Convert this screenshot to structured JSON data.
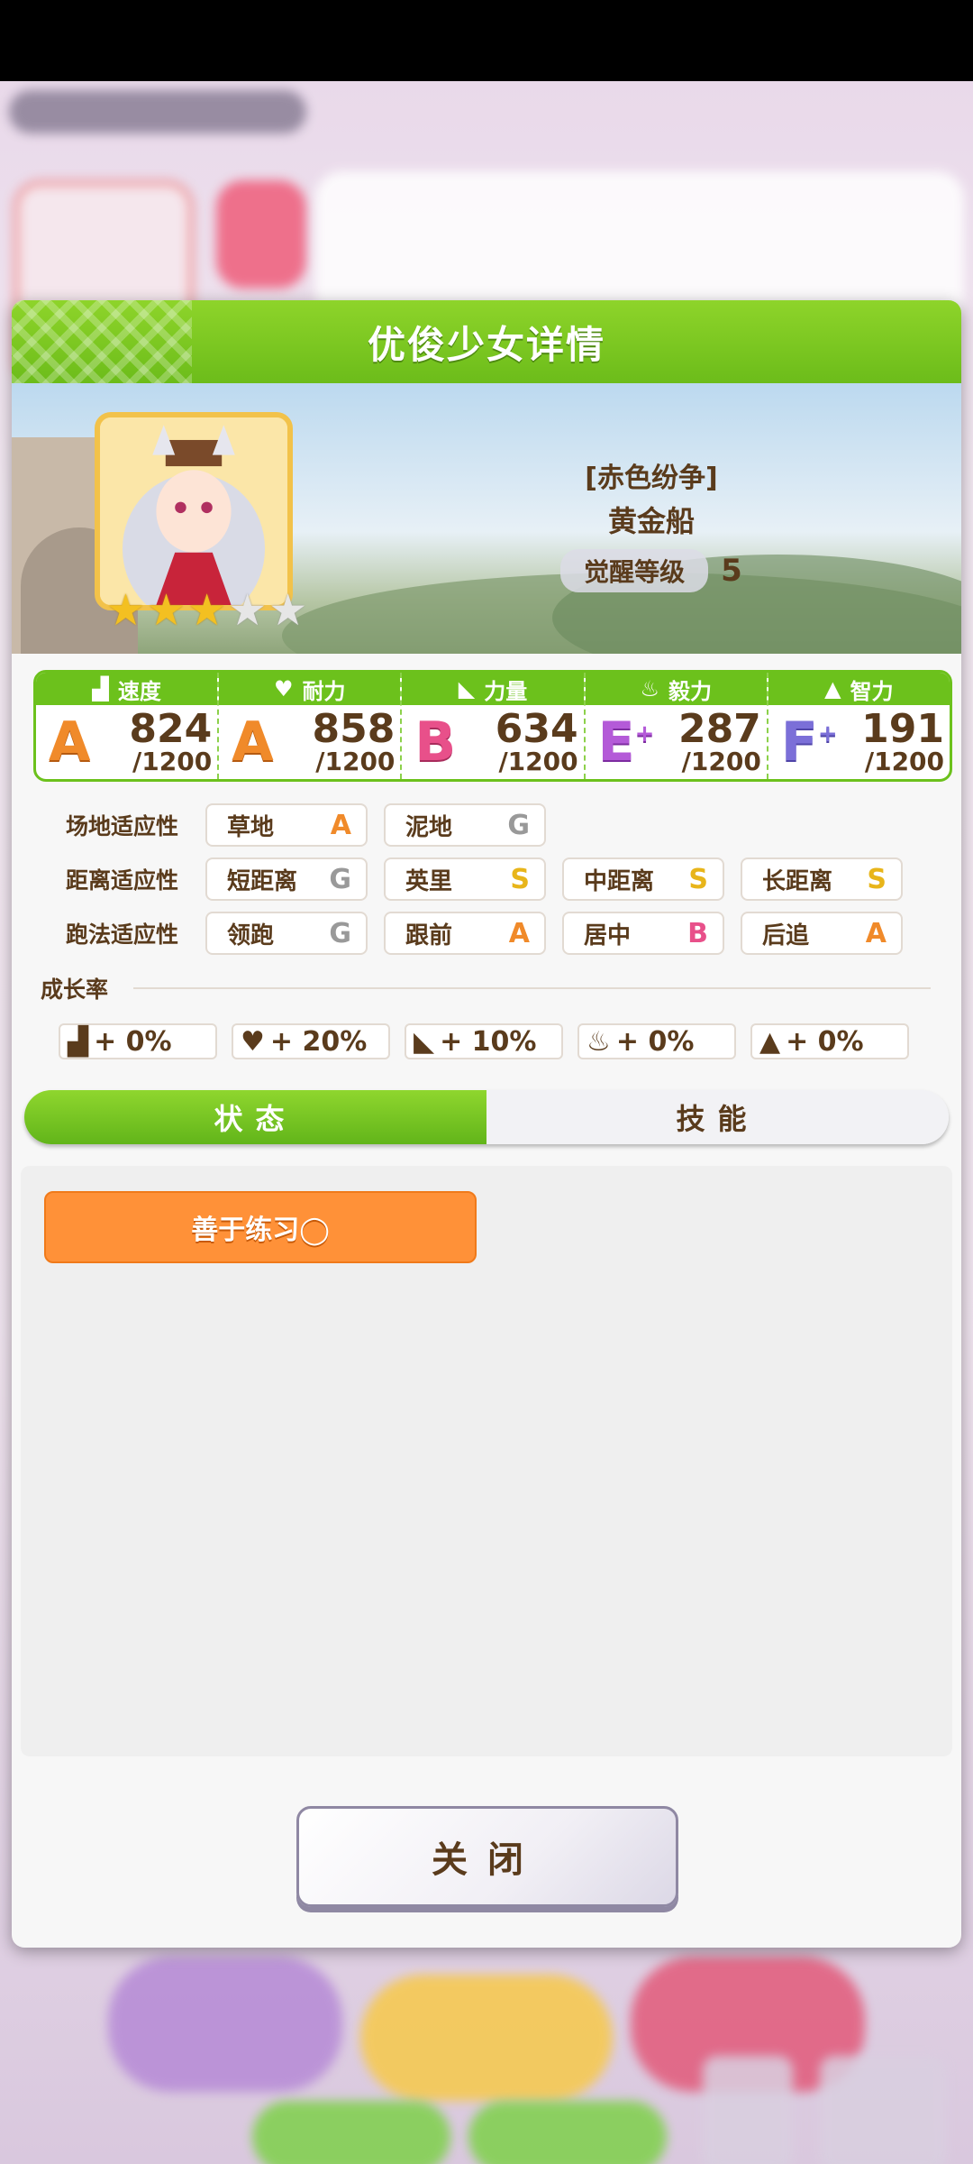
{
  "dialog": {
    "title": "优俊少女详情",
    "character": {
      "costume": "[赤色纷争]",
      "name": "黄金船",
      "awakening_label": "觉醒等级",
      "awakening_level": "5",
      "stars_filled": 3,
      "stars_total": 5
    },
    "stats": [
      {
        "label": "速度",
        "icon": "shoe-icon",
        "grade": "A",
        "plus": "",
        "value": "824",
        "max": "/1200"
      },
      {
        "label": "耐力",
        "icon": "heart-icon",
        "grade": "A",
        "plus": "",
        "value": "858",
        "max": "/1200"
      },
      {
        "label": "力量",
        "icon": "muscle-icon",
        "grade": "B",
        "plus": "",
        "value": "634",
        "max": "/1200"
      },
      {
        "label": "毅力",
        "icon": "flame-icon",
        "grade": "E",
        "plus": "+",
        "value": "287",
        "max": "/1200"
      },
      {
        "label": "智力",
        "icon": "graduation-cap-icon",
        "grade": "F",
        "plus": "+",
        "value": "191",
        "max": "/1200"
      }
    ],
    "aptitude": {
      "track": {
        "label": "场地适应性",
        "items": [
          {
            "name": "草地",
            "grade": "A"
          },
          {
            "name": "泥地",
            "grade": "G"
          }
        ]
      },
      "distance": {
        "label": "距离适应性",
        "items": [
          {
            "name": "短距离",
            "grade": "G"
          },
          {
            "name": "英里",
            "grade": "S"
          },
          {
            "name": "中距离",
            "grade": "S"
          },
          {
            "name": "长距离",
            "grade": "S"
          }
        ]
      },
      "style": {
        "label": "跑法适应性",
        "items": [
          {
            "name": "领跑",
            "grade": "G"
          },
          {
            "name": "跟前",
            "grade": "A"
          },
          {
            "name": "居中",
            "grade": "B"
          },
          {
            "name": "后追",
            "grade": "A"
          }
        ]
      }
    },
    "growth": {
      "label": "成长率",
      "items": [
        "+ 0%",
        "+ 20%",
        "+ 10%",
        "+ 0%",
        "+ 0%"
      ]
    },
    "tabs": {
      "status": "状态",
      "skills": "技能"
    },
    "status_chip": "善于练习◯",
    "close_label": "关闭"
  },
  "colors": {
    "accent_green": "#6cc11c",
    "chip_orange": "#ff9138",
    "text_brown": "#5a3b1c"
  }
}
